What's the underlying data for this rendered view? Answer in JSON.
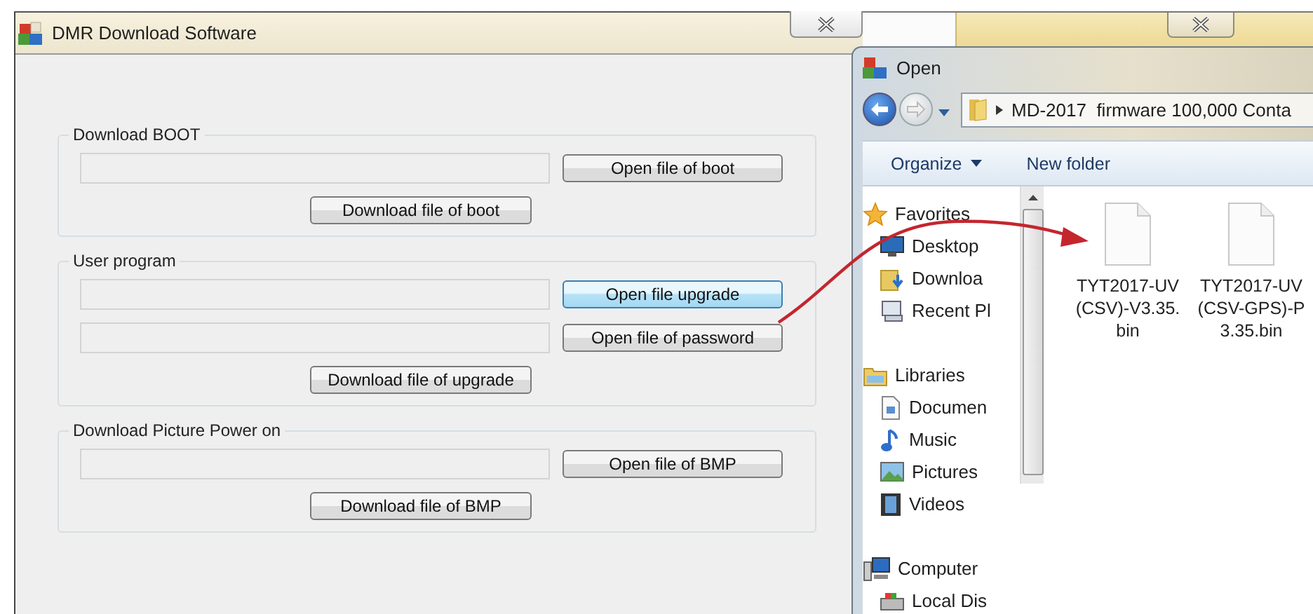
{
  "main_window": {
    "title": "DMR Download Software",
    "groups": [
      {
        "title": "Download BOOT",
        "rows": [
          {
            "kind": "field-button",
            "button": "Open file of boot",
            "highlighted": false
          },
          {
            "kind": "center-button",
            "button": "Download file of boot",
            "highlighted": false
          }
        ]
      },
      {
        "title": "User program",
        "rows": [
          {
            "kind": "field-button",
            "button": "Open file upgrade",
            "highlighted": true
          },
          {
            "kind": "field-button",
            "button": "Open file of password",
            "highlighted": false
          },
          {
            "kind": "center-button",
            "button": "Download file of upgrade",
            "highlighted": false
          }
        ]
      },
      {
        "title": "Download Picture Power on",
        "rows": [
          {
            "kind": "field-button",
            "button": "Open file of BMP",
            "highlighted": false
          },
          {
            "kind": "center-button",
            "button": "Download file of BMP",
            "highlighted": false
          }
        ]
      }
    ]
  },
  "open_dialog": {
    "title": "Open",
    "address": "MD-2017  firmware 100,000 Conta",
    "toolbar": [
      {
        "label": "Organize",
        "kind": "menu"
      },
      {
        "label": "New folder",
        "kind": "plain"
      }
    ],
    "nav": [
      {
        "label": "Favorites",
        "children": [
          {
            "label": "Desktop"
          },
          {
            "label": "Downloa"
          },
          {
            "label": "Recent Pl"
          }
        ]
      },
      {
        "label": "Libraries",
        "children": [
          {
            "label": "Documen"
          },
          {
            "label": "Music"
          },
          {
            "label": "Pictures"
          },
          {
            "label": "Videos"
          }
        ]
      },
      {
        "label": "Computer",
        "children": [
          {
            "label": "Local Dis"
          }
        ]
      }
    ],
    "files": [
      {
        "name": "TYT2017-UV(CSV)-V3.35.bin"
      },
      {
        "name": "TYT2017-UV(CSV-GPS)-P3.35.bin"
      }
    ]
  }
}
